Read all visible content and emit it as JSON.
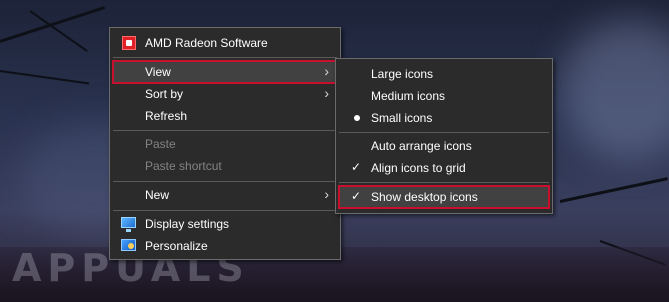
{
  "watermark": "APPUALS",
  "context_menu": {
    "items": [
      {
        "label": "AMD Radeon Software",
        "icon": "amd-radeon-icon"
      },
      {
        "label": "View",
        "submenu": true,
        "highlighted": true
      },
      {
        "label": "Sort by",
        "submenu": true
      },
      {
        "label": "Refresh"
      },
      {
        "label": "Paste",
        "disabled": true
      },
      {
        "label": "Paste shortcut",
        "disabled": true
      },
      {
        "label": "New",
        "submenu": true
      },
      {
        "label": "Display settings",
        "icon": "display-settings-icon"
      },
      {
        "label": "Personalize",
        "icon": "personalize-icon"
      }
    ]
  },
  "view_submenu": {
    "items": [
      {
        "label": "Large icons"
      },
      {
        "label": "Medium icons"
      },
      {
        "label": "Small icons",
        "selected": true
      },
      {
        "label": "Auto arrange icons"
      },
      {
        "label": "Align icons to grid",
        "checked": true
      },
      {
        "label": "Show desktop icons",
        "checked": true,
        "highlighted": true
      }
    ]
  },
  "colors": {
    "menu_background": "#2b2b2b",
    "hover_background": "#414141",
    "highlight_outline": "#c8102e",
    "disabled_text": "#838383"
  }
}
